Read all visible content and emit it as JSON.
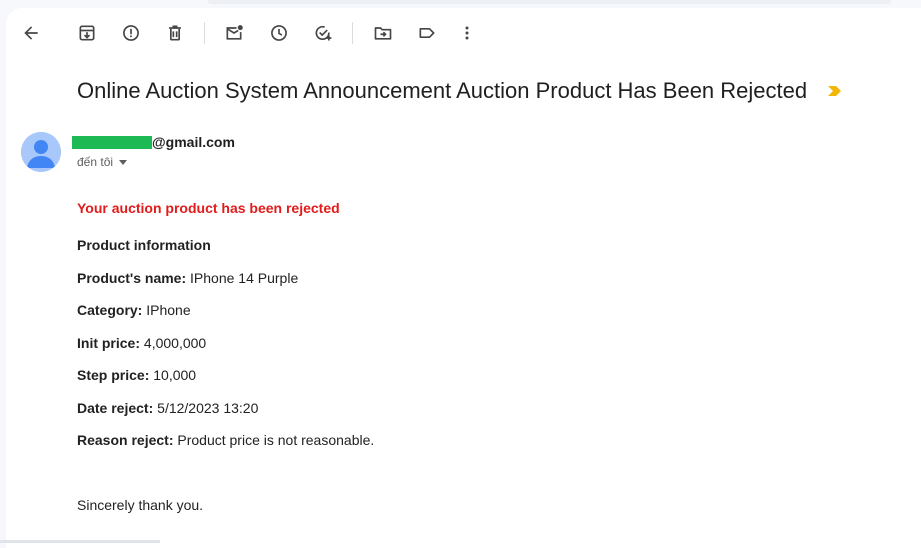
{
  "toolbar": {
    "buttons": [
      {
        "name": "back-icon"
      },
      {
        "name": "archive-icon"
      },
      {
        "name": "report-spam-icon"
      },
      {
        "name": "delete-icon"
      },
      {
        "name": "mark-unread-icon"
      },
      {
        "name": "snooze-icon"
      },
      {
        "name": "add-to-tasks-icon"
      },
      {
        "name": "move-to-icon"
      },
      {
        "name": "label-icon"
      },
      {
        "name": "more-options-icon"
      }
    ]
  },
  "subject": "Online Auction System Announcement Auction Product Has Been Rejected",
  "colors": {
    "importance_marker": "#f2b705",
    "red_heading": "#e21b1b",
    "redaction": "#1db954",
    "avatar_bg": "#a8c7fa",
    "avatar_fg": "#4285f4"
  },
  "sender": {
    "email_suffix": "@gmail.com",
    "to_label": "đến tôi"
  },
  "message": {
    "heading": "Your auction product has been rejected",
    "section_title": "Product information",
    "fields": [
      {
        "label": "Product's name:",
        "value": "IPhone 14 Purple"
      },
      {
        "label": "Category:",
        "value": "IPhone"
      },
      {
        "label": "Init price:",
        "value": "4,000,000"
      },
      {
        "label": "Step price:",
        "value": "10,000"
      },
      {
        "label": "Date reject:",
        "value": "5/12/2023 13:20"
      },
      {
        "label": "Reason reject:",
        "value": "Product price is not reasonable."
      }
    ],
    "closing": "Sincerely thank you."
  }
}
